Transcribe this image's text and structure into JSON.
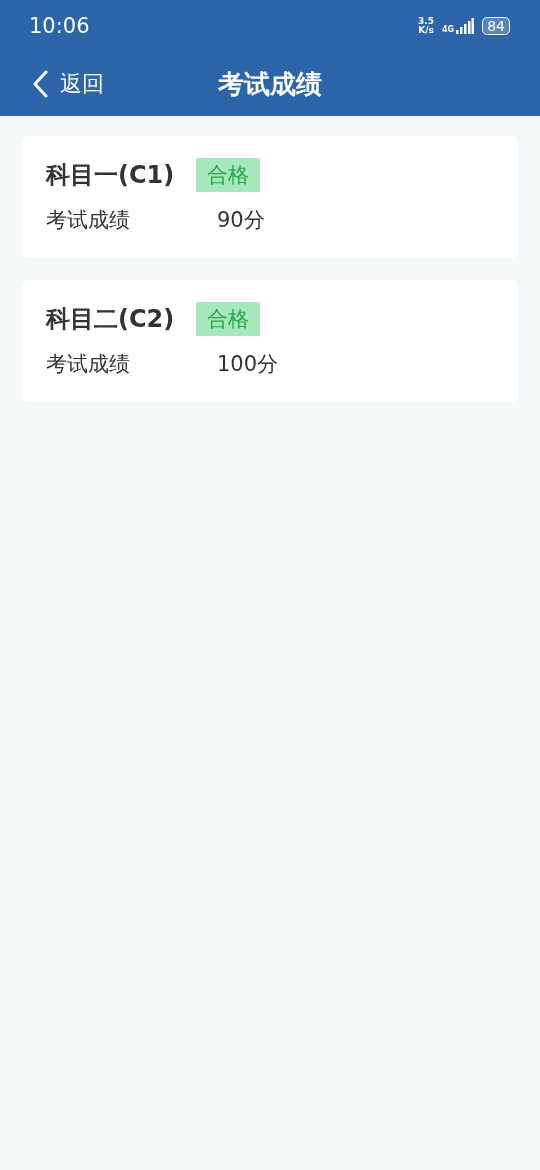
{
  "status_bar": {
    "time": "10:06",
    "net_speed": "3.5\nK/s",
    "network": "4G",
    "battery": "84"
  },
  "nav_bar": {
    "back_label": "返回",
    "title": "考试成绩"
  },
  "subjects": [
    {
      "name": "科目一(C1)",
      "result": "合格",
      "kind": "pass",
      "score_label": "考试成绩",
      "score": "90分"
    },
    {
      "name": "科目二(C2)",
      "result": "合格",
      "kind": "pass",
      "score_label": "考试成绩",
      "score": "100分"
    }
  ]
}
